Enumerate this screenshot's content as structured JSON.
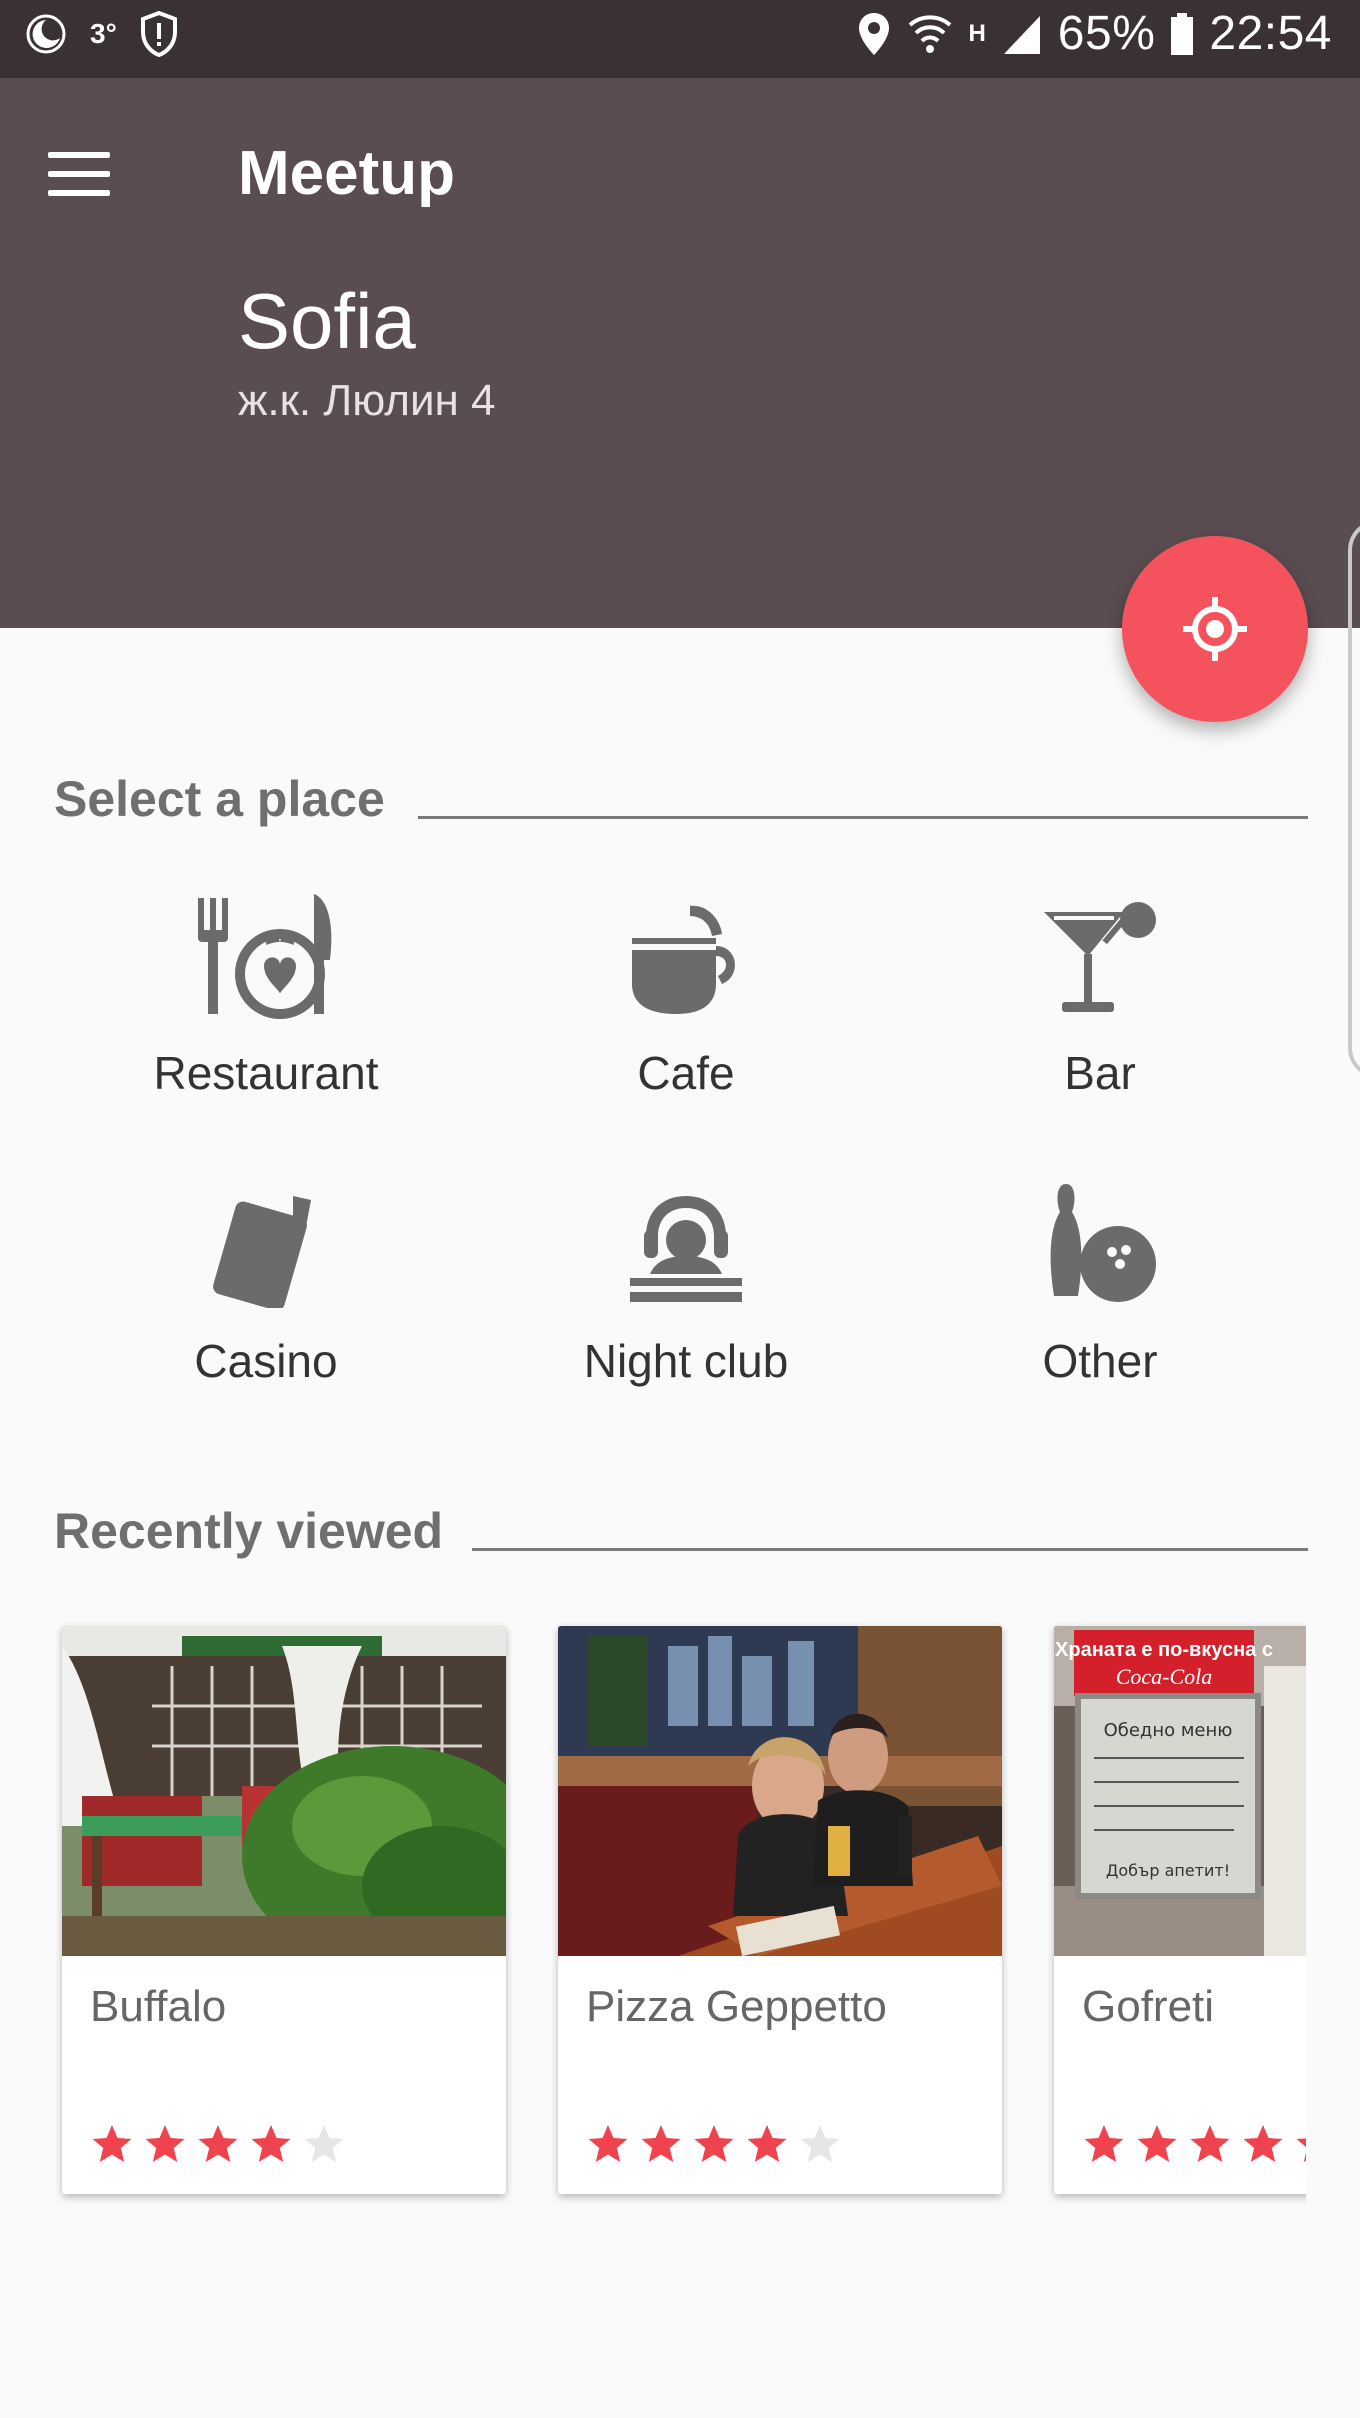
{
  "status_bar": {
    "temperature": "3°",
    "battery_percent": "65%",
    "time": "22:54",
    "network_type": "H",
    "icons": [
      "moon-icon",
      "shield-alert-icon",
      "location-icon",
      "wifi-icon",
      "signal-icon",
      "battery-icon"
    ]
  },
  "app_bar": {
    "title": "Meetup",
    "city": "Sofia",
    "address": "ж.к. Люлин 4",
    "background_color": "#5a4d51"
  },
  "fab": {
    "icon": "my-location-icon",
    "color": "#f4535e"
  },
  "select_place": {
    "heading": "Select a place",
    "categories": [
      {
        "label": "Restaurant",
        "icon": "restaurant-icon"
      },
      {
        "label": "Cafe",
        "icon": "cafe-icon"
      },
      {
        "label": "Bar",
        "icon": "bar-icon"
      },
      {
        "label": "Casino",
        "icon": "casino-icon"
      },
      {
        "label": "Night club",
        "icon": "night-club-icon"
      },
      {
        "label": "Other",
        "icon": "bowling-icon"
      }
    ]
  },
  "recently_viewed": {
    "heading": "Recently viewed",
    "places": [
      {
        "name": "Buffalo",
        "rating": 4,
        "max_rating": 5
      },
      {
        "name": "Pizza Geppetto",
        "rating": 4,
        "max_rating": 5
      },
      {
        "name": "Gofreti",
        "rating": 5,
        "max_rating": 5
      }
    ]
  },
  "photo_signage": {
    "gofreti_sign_top": "Храната е по-вкусна с",
    "gofreti_sign_brand": "Coca-Cola",
    "gofreti_board_title": "Обедно меню",
    "gofreti_board_footer": "Добър апетит!"
  },
  "colors": {
    "accent": "#f4535e",
    "star_filled": "#f0434e",
    "star_empty": "#e6e6e6",
    "icon_gray": "#6b6b6b"
  }
}
